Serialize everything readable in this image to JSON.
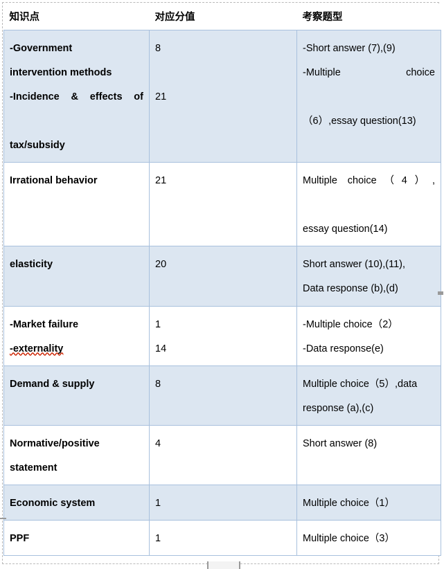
{
  "document": {
    "type": "word-table",
    "colors": {
      "shaded_row_bg": "#dce6f1",
      "plain_row_bg": "#ffffff",
      "cell_border": "#a8c0dd",
      "text_boundary": "#b9b9b9",
      "spellcheck_underline": "#cc2200"
    }
  },
  "table": {
    "headers": {
      "knowledge_point": "知识点",
      "score_value": "对应分值",
      "question_type": "考察题型"
    },
    "rows": [
      {
        "shaded": true,
        "knowledge_lines": [
          "-Government",
          "intervention methods",
          "-Incidence & effects of",
          "tax/subsidy"
        ],
        "score_lines": [
          "8",
          "",
          "21",
          ""
        ],
        "question_lines": [
          "-Short answer (7),(9)",
          "-Multiple choice",
          "（6）,essay question(13)",
          ""
        ]
      },
      {
        "shaded": false,
        "knowledge_lines": [
          "Irrational behavior",
          ""
        ],
        "score_lines": [
          "21",
          ""
        ],
        "question_lines": [
          "Multiple choice（4）,",
          "essay question(14)"
        ]
      },
      {
        "shaded": true,
        "knowledge_lines": [
          "elasticity",
          ""
        ],
        "score_lines": [
          "20",
          ""
        ],
        "question_lines": [
          "Short answer (10),(11),",
          "Data response (b),(d)"
        ]
      },
      {
        "shaded": false,
        "knowledge_lines": [
          "-Market failure",
          "-externality"
        ],
        "score_lines": [
          "1",
          "14"
        ],
        "question_lines": [
          "-Multiple choice（2）",
          "-Data response(e)"
        ]
      },
      {
        "shaded": true,
        "knowledge_lines": [
          "Demand & supply",
          ""
        ],
        "score_lines": [
          "8",
          ""
        ],
        "question_lines": [
          "Multiple choice（5）,data",
          "response (a),(c)"
        ]
      },
      {
        "shaded": false,
        "knowledge_lines": [
          "Normative/positive",
          "statement"
        ],
        "score_lines": [
          "4",
          ""
        ],
        "question_lines": [
          "Short answer (8)",
          ""
        ]
      },
      {
        "shaded": true,
        "knowledge_lines": [
          "Economic system"
        ],
        "score_lines": [
          "1"
        ],
        "question_lines": [
          "Multiple choice（1）"
        ]
      },
      {
        "shaded": false,
        "knowledge_lines": [
          "PPF"
        ],
        "score_lines": [
          "1"
        ],
        "question_lines": [
          "Multiple choice（3）"
        ]
      }
    ]
  }
}
